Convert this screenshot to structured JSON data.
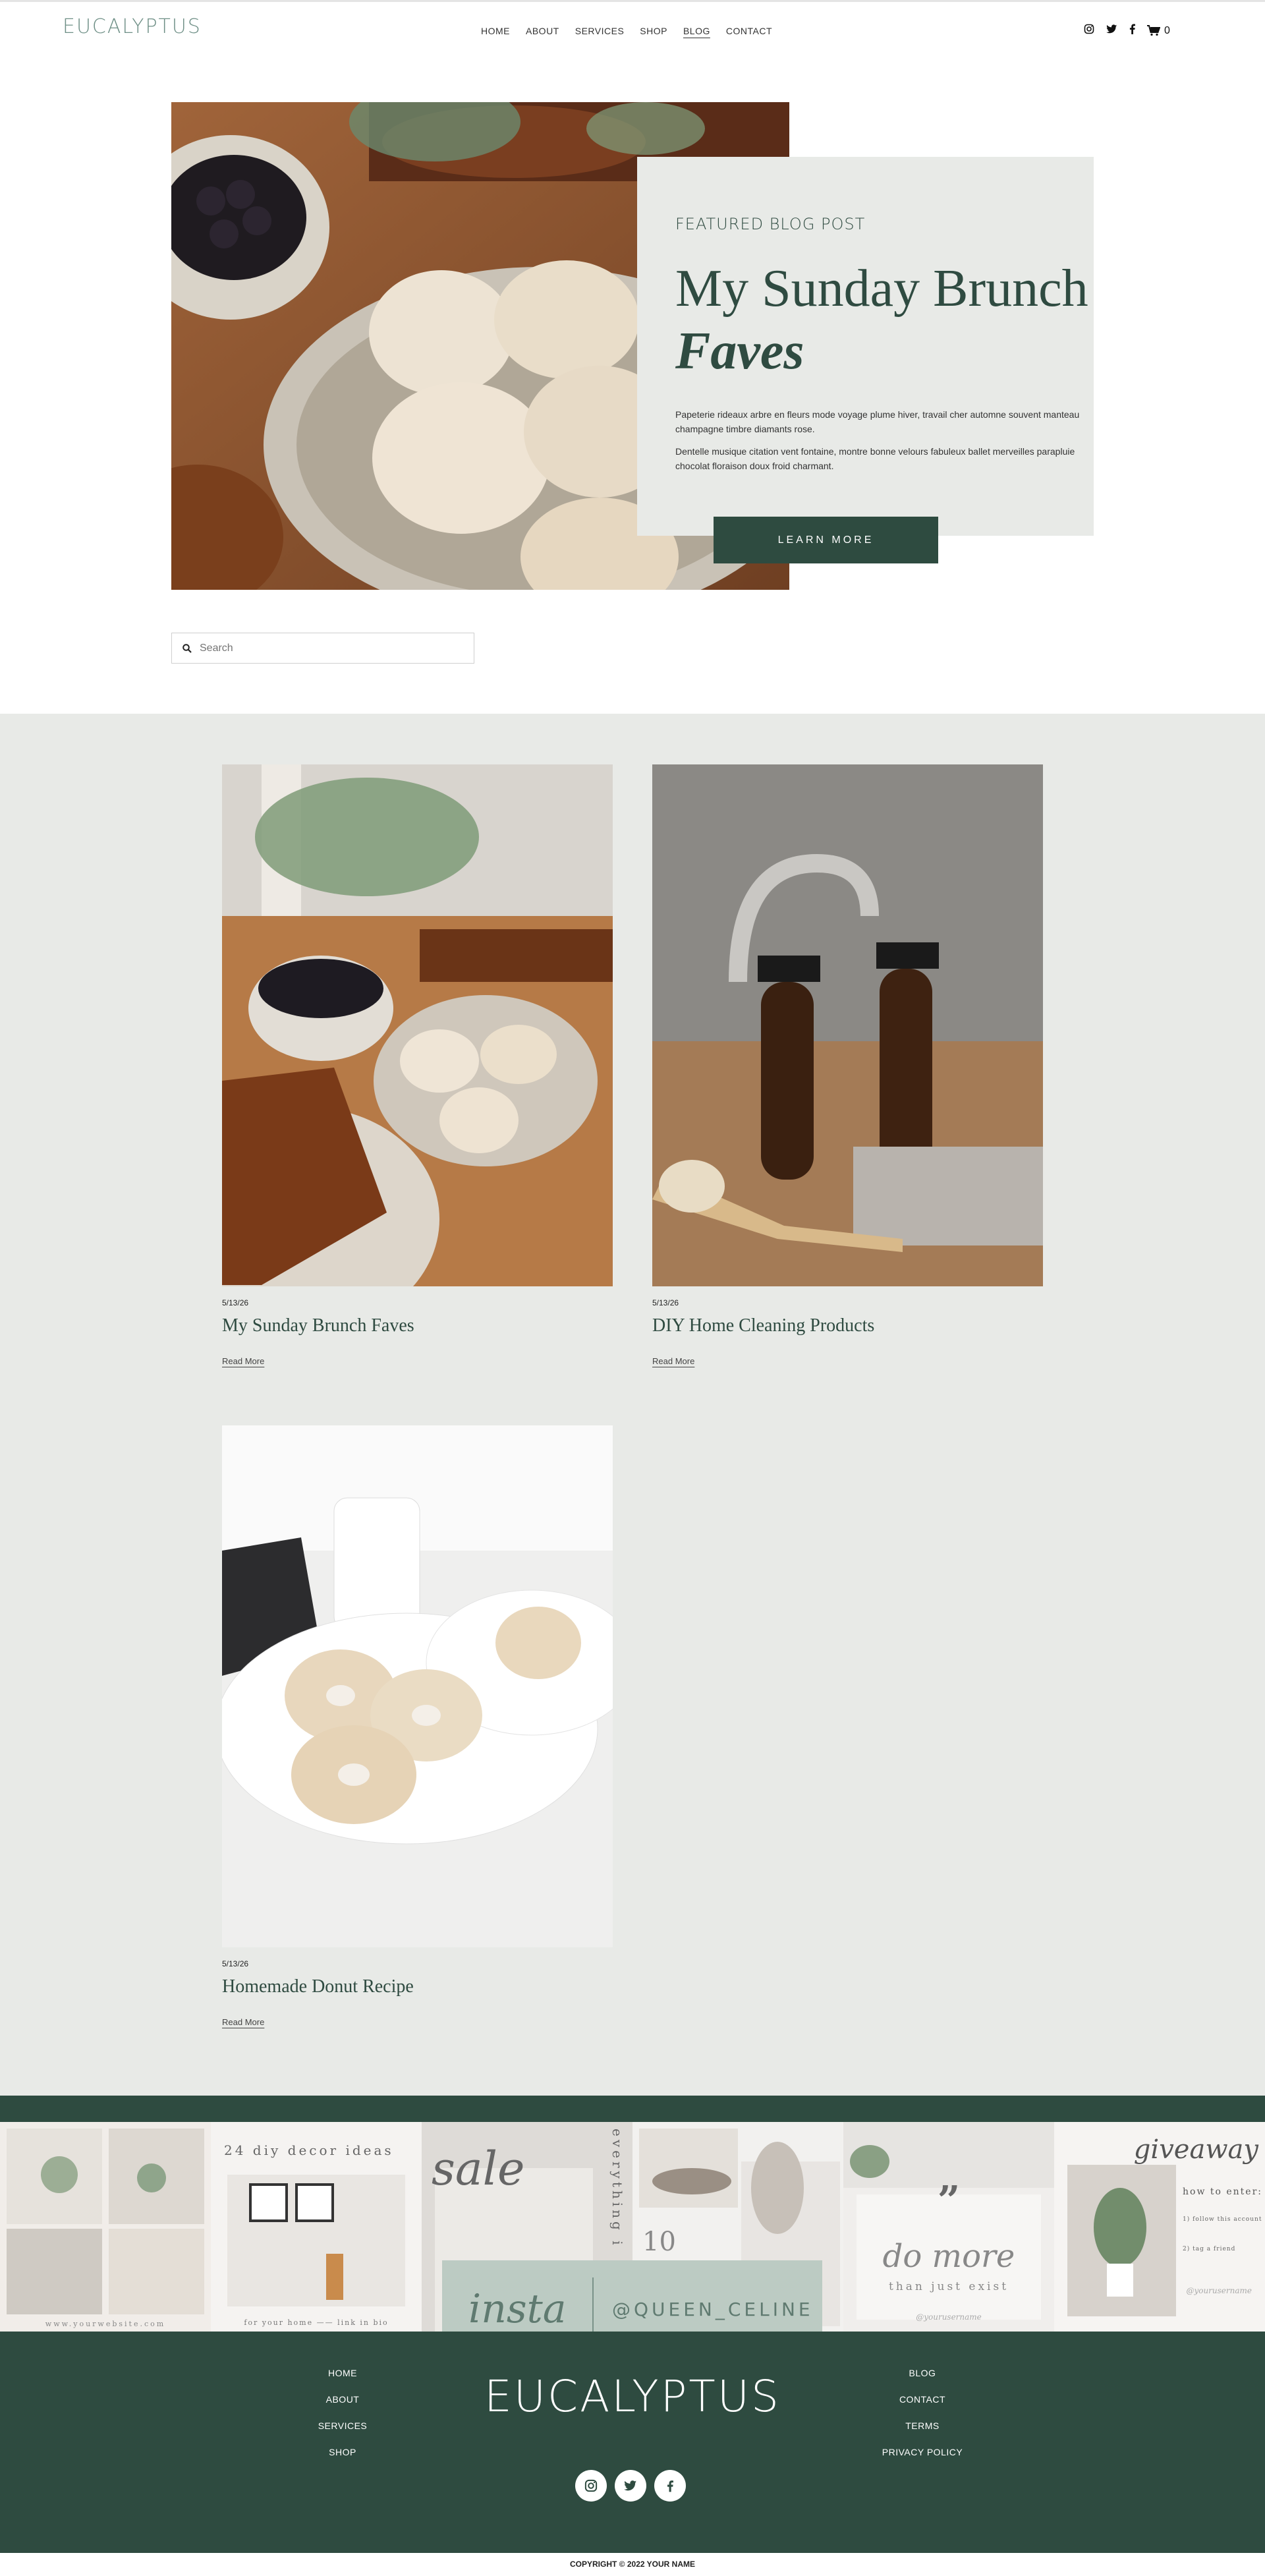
{
  "header": {
    "logo": "EUCALYPTUS",
    "nav": [
      "HOME",
      "ABOUT",
      "SERVICES",
      "SHOP",
      "BLOG",
      "CONTACT"
    ],
    "active_nav": "BLOG",
    "social_icons": [
      "instagram-icon",
      "twitter-icon",
      "facebook-icon"
    ],
    "cart_count": "0"
  },
  "hero": {
    "eyebrow": "FEATURED BLOG POST",
    "title_line1": "My Sunday Brunch",
    "title_line2": "Faves",
    "body1": "Papeterie rideaux arbre en fleurs mode voyage plume hiver, travail cher automne souvent manteau champagne timbre diamants rose.",
    "body2": "Dentelle musique citation vent fontaine, montre bonne velours fabuleux ballet merveilles parapluie chocolat floraison doux froid charmant.",
    "button": "LEARN MORE"
  },
  "search": {
    "placeholder": "Search"
  },
  "posts": [
    {
      "date": "5/13/26",
      "title": "My Sunday Brunch Faves",
      "read_more": "Read More"
    },
    {
      "date": "5/13/26",
      "title": "DIY Home Cleaning Products",
      "read_more": "Read More"
    },
    {
      "date": "5/13/26",
      "title": "Homemade Donut Recipe",
      "read_more": "Read More"
    }
  ],
  "instagram": {
    "script": "insta",
    "handle": "@QUEEN_CELINE",
    "tiles": [
      {
        "caption": "www.yourwebsite.com"
      },
      {
        "headline": "24 diy decor ideas",
        "caption": "for your home —— link in bio"
      },
      {
        "headline": "sale",
        "side": "everything i"
      },
      {
        "number": "10"
      },
      {
        "headline": "do more",
        "sub": "than just exist",
        "caption": "@yourusername"
      },
      {
        "headline": "giveaway",
        "sub": "how to enter:",
        "rules": [
          "1) follow this account",
          "2) tag a friend"
        ],
        "caption": "@yourusername"
      }
    ]
  },
  "footer": {
    "left_links": [
      "HOME",
      "ABOUT",
      "SERVICES",
      "SHOP"
    ],
    "right_links": [
      "BLOG",
      "CONTACT",
      "TERMS",
      "PRIVACY POLICY"
    ],
    "logo": "EUCALYPTUS",
    "copyright": "COPYRIGHT © 2022 YOUR NAME"
  },
  "colors": {
    "accent": "#2e4b40",
    "card_bg": "#e8eae7",
    "insta_badge": "#bccbc3"
  }
}
